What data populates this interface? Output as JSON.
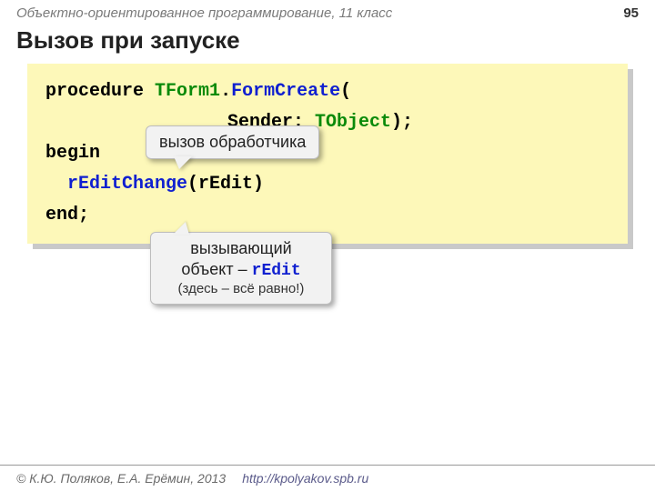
{
  "header": {
    "course": "Объектно-ориентированное программирование, 11 класс",
    "page": "95"
  },
  "title": "Вызов при запуске",
  "code": {
    "kw_procedure": "procedure",
    "class_name": "TForm1",
    "dot": ".",
    "method_name": "FormCreate",
    "open": "(",
    "param_line": "Sender: ",
    "param_type": "TObject",
    "close_line": ");",
    "kw_begin": "begin",
    "call_name": "rEditChange",
    "call_args": "(rEdit)",
    "kw_end": "end;"
  },
  "callouts": {
    "c1": "вызов обработчика",
    "c2_line1a": "вызывающий",
    "c2_line2a": "объект – ",
    "c2_mono": "rEdit",
    "c2_small": "(здесь – всё равно!)"
  },
  "footer": {
    "copyright": "© К.Ю. Поляков, Е.А. Ерёмин, 2013",
    "url": "http://kpolyakov.spb.ru"
  }
}
